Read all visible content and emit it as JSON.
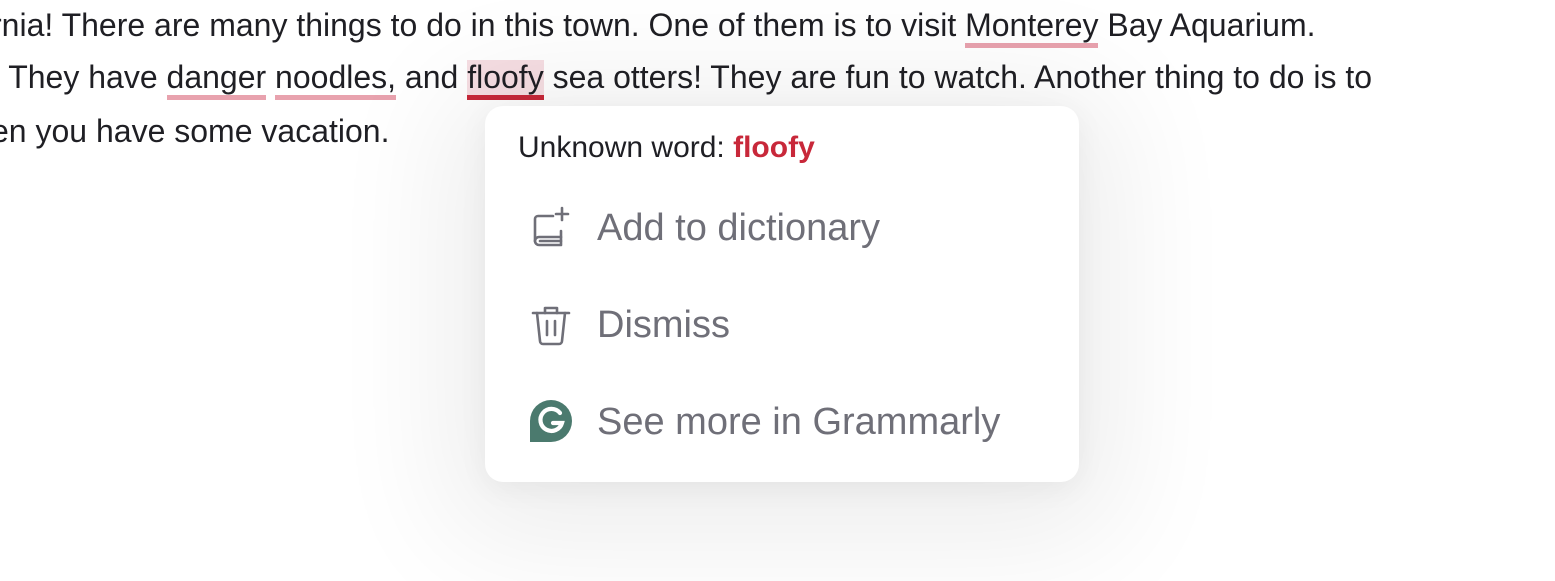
{
  "document": {
    "line1": {
      "before": "rnia! There are many things to do in this town. One of them is to visit ",
      "flag1": "Monterey",
      "after": " Bay Aquarium."
    },
    "line2": {
      "before": ". They have ",
      "flag1": "danger",
      "between1": " ",
      "flag2": "noodles,",
      "between2": " and ",
      "flag3": "floofy",
      "after": " sea otters! They are fun to watch. Another thing to do is to"
    },
    "line3": {
      "text": "en you have some vacation."
    }
  },
  "popup": {
    "header_prefix": "Unknown word: ",
    "word": "floofy",
    "items": [
      {
        "label": "Add to dictionary",
        "icon": "add-to-dictionary-icon"
      },
      {
        "label": "Dismiss",
        "icon": "trash-icon"
      },
      {
        "label": "See more in Grammarly",
        "icon": "grammarly-logo-icon"
      }
    ]
  },
  "colors": {
    "underline": "#e8a2ae",
    "active_underline": "#c8283a",
    "active_highlight": "#f6dee3",
    "word_accent": "#c8283a",
    "menu_text": "#6f6f78",
    "grammarly_green": "#4b7a6e"
  }
}
